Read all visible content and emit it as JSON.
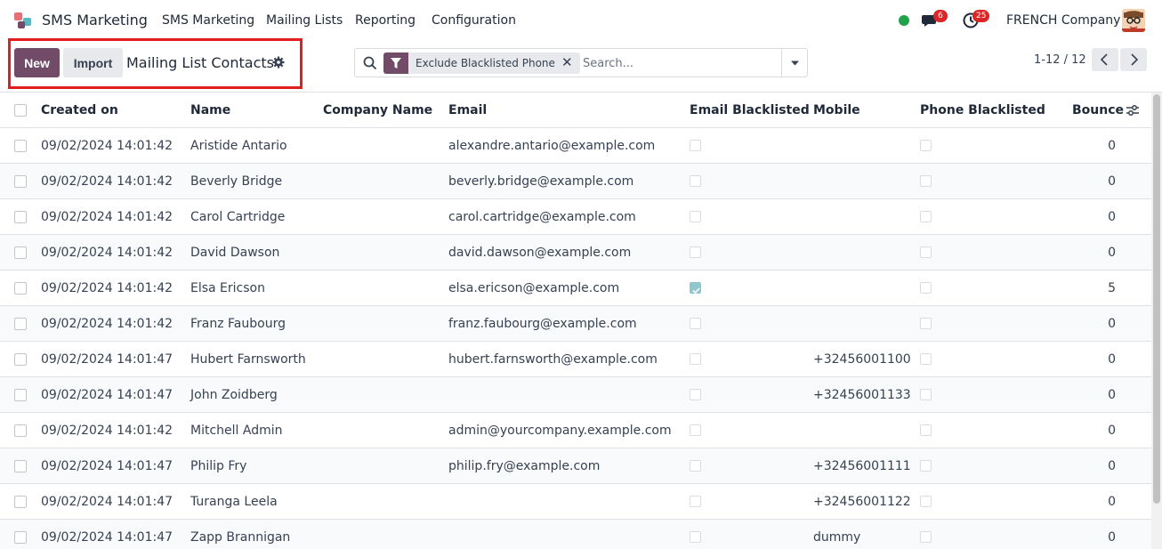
{
  "navbar": {
    "app_name": "SMS Marketing",
    "menu": [
      "SMS Marketing",
      "Mailing Lists",
      "Reporting",
      "Configuration"
    ],
    "chat_badge": "6",
    "activity_badge": "25",
    "company": "FRENCH Company",
    "icons": [
      "app-logo-icon",
      "chat-icon",
      "clock-icon"
    ],
    "status_color": "#22a34b"
  },
  "control": {
    "new_label": "New",
    "import_label": "Import",
    "title": "Mailing List Contacts",
    "facet_label": "Exclude Blacklisted Phone",
    "search_placeholder": "Search...",
    "pager": "1-12 / 12"
  },
  "colors": {
    "brand": "#714b67",
    "highlight": "#e11d1d"
  },
  "table": {
    "columns": [
      "Created on",
      "Name",
      "Company Name",
      "Email",
      "Email Blacklisted",
      "Mobile",
      "Phone Blacklisted",
      "Bounce"
    ],
    "rows": [
      {
        "created": "09/02/2024 14:01:42",
        "name": "Aristide Antario",
        "company": "",
        "email": "alexandre.antario@example.com",
        "email_bl": false,
        "mobile": "",
        "phone_bl": false,
        "bounce": "0"
      },
      {
        "created": "09/02/2024 14:01:42",
        "name": "Beverly Bridge",
        "company": "",
        "email": "beverly.bridge@example.com",
        "email_bl": false,
        "mobile": "",
        "phone_bl": false,
        "bounce": "0"
      },
      {
        "created": "09/02/2024 14:01:42",
        "name": "Carol Cartridge",
        "company": "",
        "email": "carol.cartridge@example.com",
        "email_bl": false,
        "mobile": "",
        "phone_bl": false,
        "bounce": "0"
      },
      {
        "created": "09/02/2024 14:01:42",
        "name": "David Dawson",
        "company": "",
        "email": "david.dawson@example.com",
        "email_bl": false,
        "mobile": "",
        "phone_bl": false,
        "bounce": "0"
      },
      {
        "created": "09/02/2024 14:01:42",
        "name": "Elsa Ericson",
        "company": "",
        "email": "elsa.ericson@example.com",
        "email_bl": true,
        "mobile": "",
        "phone_bl": false,
        "bounce": "5"
      },
      {
        "created": "09/02/2024 14:01:42",
        "name": "Franz Faubourg",
        "company": "",
        "email": "franz.faubourg@example.com",
        "email_bl": false,
        "mobile": "",
        "phone_bl": false,
        "bounce": "0"
      },
      {
        "created": "09/02/2024 14:01:47",
        "name": "Hubert Farnsworth",
        "company": "",
        "email": "hubert.farnsworth@example.com",
        "email_bl": false,
        "mobile": "+32456001100",
        "phone_bl": false,
        "bounce": "0"
      },
      {
        "created": "09/02/2024 14:01:47",
        "name": "John Zoidberg",
        "company": "",
        "email": "",
        "email_bl": false,
        "mobile": "+32456001133",
        "phone_bl": false,
        "bounce": "0"
      },
      {
        "created": "09/02/2024 14:01:42",
        "name": "Mitchell Admin",
        "company": "",
        "email": "admin@yourcompany.example.com",
        "email_bl": false,
        "mobile": "",
        "phone_bl": false,
        "bounce": "0"
      },
      {
        "created": "09/02/2024 14:01:47",
        "name": "Philip Fry",
        "company": "",
        "email": "philip.fry@example.com",
        "email_bl": false,
        "mobile": "+32456001111",
        "phone_bl": false,
        "bounce": "0"
      },
      {
        "created": "09/02/2024 14:01:47",
        "name": "Turanga Leela",
        "company": "",
        "email": "",
        "email_bl": false,
        "mobile": "+32456001122",
        "phone_bl": false,
        "bounce": "0"
      },
      {
        "created": "09/02/2024 14:01:47",
        "name": "Zapp Brannigan",
        "company": "",
        "email": "",
        "email_bl": false,
        "mobile": "dummy",
        "phone_bl": false,
        "bounce": "0"
      }
    ]
  }
}
